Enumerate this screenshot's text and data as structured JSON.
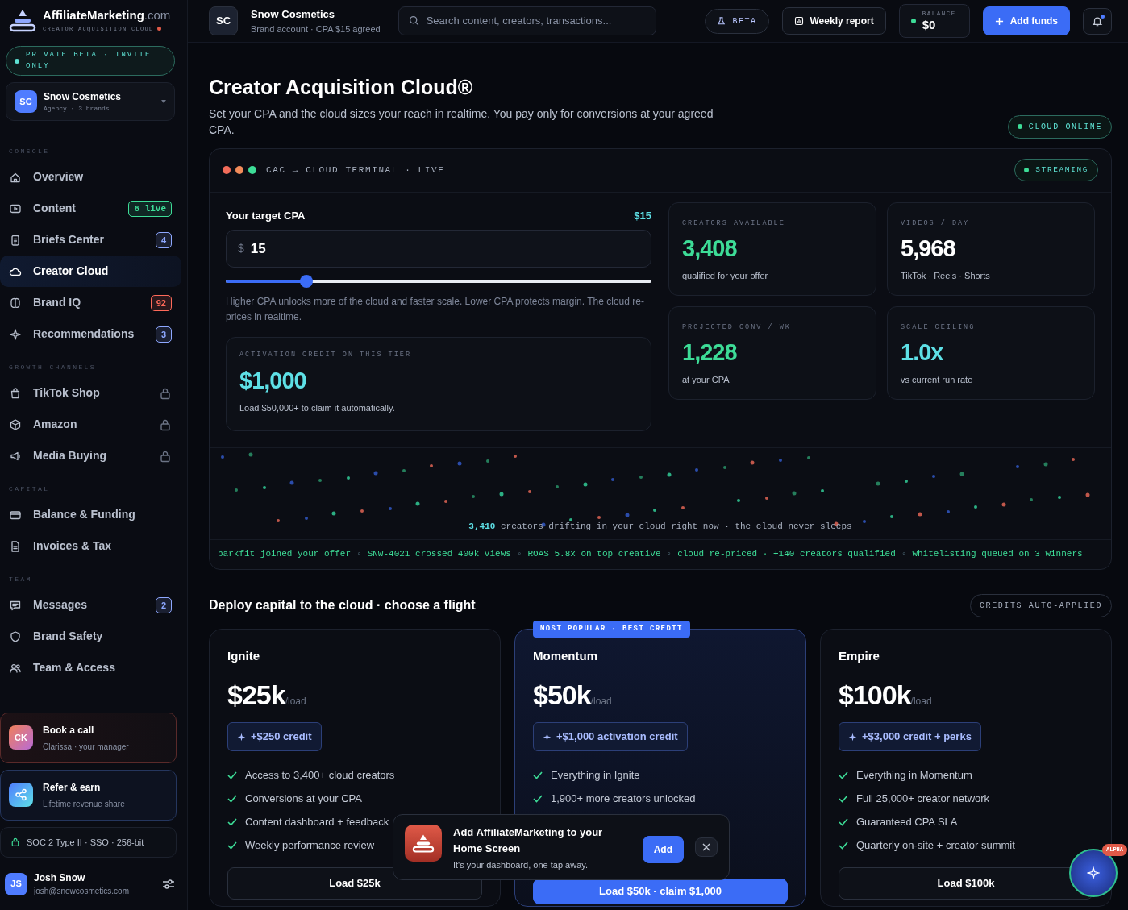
{
  "brand": {
    "name": "AffiliateMarketing",
    "suffix": ".com",
    "tagline": "CREATOR ACQUISITION CLOUD"
  },
  "beta_pill": "PRIVATE BETA · INVITE ONLY",
  "account_switcher": {
    "initials": "SC",
    "name": "Snow Cosmetics",
    "meta": "Agency · 3 brands"
  },
  "nav_sections": [
    {
      "heading": "CONSOLE",
      "items": [
        {
          "label": "Overview",
          "selected": false,
          "locked": false
        },
        {
          "label": "Content",
          "selected": false,
          "locked": false,
          "badge": "6 live",
          "color": "#3ddc97"
        },
        {
          "label": "Briefs Center",
          "selected": false,
          "locked": false,
          "badge": "4",
          "color": "#8ea8ff"
        },
        {
          "label": "Creator Cloud",
          "selected": true,
          "locked": false
        },
        {
          "label": "Brand IQ",
          "selected": false,
          "locked": false,
          "badge": "92",
          "color": "#ff6a5a"
        },
        {
          "label": "Recommendations",
          "selected": false,
          "locked": false,
          "badge": "3",
          "color": "#8ea8ff"
        }
      ]
    },
    {
      "heading": "GROWTH CHANNELS",
      "items": [
        {
          "label": "TikTok Shop",
          "selected": false,
          "locked": true
        },
        {
          "label": "Amazon",
          "selected": false,
          "locked": true
        },
        {
          "label": "Media Buying",
          "selected": false,
          "locked": true
        }
      ]
    },
    {
      "heading": "CAPITAL",
      "items": [
        {
          "label": "Balance & Funding",
          "selected": false,
          "locked": false
        },
        {
          "label": "Invoices & Tax",
          "selected": false,
          "locked": false
        }
      ]
    },
    {
      "heading": "TEAM",
      "items": [
        {
          "label": "Messages",
          "selected": false,
          "locked": false,
          "badge": "2",
          "color": "#8ea8ff"
        },
        {
          "label": "Brand Safety",
          "selected": false,
          "locked": false
        },
        {
          "label": "Team & Access",
          "selected": false,
          "locked": false
        }
      ]
    }
  ],
  "side_cards": [
    {
      "kind": "call",
      "initials": "CK",
      "title": "Book a call",
      "subtitle": "Clarissa · your manager"
    },
    {
      "kind": "refer",
      "title": "Refer & earn",
      "subtitle": "Lifetime revenue share"
    }
  ],
  "security_note": "SOC 2 Type II · SSO · 256-bit",
  "user": {
    "initials": "JS",
    "name": "Josh Snow",
    "email": "josh@snowcosmetics.com"
  },
  "topbar": {
    "initials": "SC",
    "name": "Snow Cosmetics",
    "meta": "Brand account · CPA $15 agreed",
    "search": {
      "placeholder": "Search content, creators, transactions..."
    },
    "beta": "BETA",
    "report": "Weekly report",
    "balance": {
      "label": "BALANCE",
      "value": "$0"
    },
    "add_funds": "Add funds",
    "notifications_unread": true
  },
  "hero": {
    "title": "Creator Acquisition Cloud®",
    "subtitle": "Set your CPA and the cloud sizes your reach in realtime. You pay only for conversions at your agreed CPA.",
    "status": "CLOUD ONLINE"
  },
  "terminal": {
    "title": "CAC → CLOUD TERMINAL · LIVE",
    "status": "STREAMING",
    "cpa": {
      "label": "Your target CPA",
      "reading": "$15",
      "currency": "$",
      "value": "15",
      "level": 0.19,
      "help": "Higher CPA unlocks more of the cloud and faster scale. Lower CPA protects margin. The cloud re-prices in realtime."
    },
    "credit": {
      "label": "ACTIVATION CREDIT ON THIS TIER",
      "value": "$1,000",
      "note": "Load $50,000+ to claim it automatically."
    },
    "stats": [
      {
        "label": "CREATORS AVAILABLE",
        "value": "3,408",
        "caption": "qualified for your offer",
        "color": "#3ddc97"
      },
      {
        "label": "VIDEOS / DAY",
        "value": "5,968",
        "caption": "TikTok · Reels · Shorts",
        "color": "#ffffff"
      },
      {
        "label": "PROJECTED CONV / WK",
        "value": "1,228",
        "caption": "at your CPA",
        "color": "#3ddc97"
      },
      {
        "label": "SCALE CEILING",
        "value": "1.0x",
        "caption": "vs current run rate",
        "color": "#5ee0e6"
      }
    ],
    "drift_caption": "**3,410** creators drifting in your cloud right now · the cloud never sleeps",
    "ticker": {
      "separator": "◦",
      "items": [
        "parkfit joined your offer",
        "SNW-4021 crossed 400k views",
        "ROAS 5.8x on top creative",
        "cloud re-priced · +140 creators qualified",
        "whitelisting queued on 3 winners"
      ]
    }
  },
  "plans_section": {
    "heading": "Deploy capital to the cloud · choose a flight",
    "badge": "CREDITS AUTO-APPLIED",
    "plans": [
      {
        "name": "Ignite",
        "price": "$25k",
        "unit": "/load",
        "credit": "+$250 credit",
        "featured": false,
        "features": [
          "Access to 3,400+ cloud creators",
          "Conversions at your CPA",
          "Content dashboard + feedback",
          "Weekly performance review"
        ],
        "cta": "Load $25k"
      },
      {
        "name": "Momentum",
        "price": "$50k",
        "unit": "/load",
        "credit": "+$1,000 activation credit",
        "featured": true,
        "ribbon": "MOST POPULAR · BEST CREDIT",
        "features": [
          "Everything in Ignite",
          "1,900+ more creators unlocked"
        ],
        "cta": "Load $50k · claim $1,000"
      },
      {
        "name": "Empire",
        "price": "$100k",
        "unit": "/load",
        "credit": "+$3,000 credit + perks",
        "featured": false,
        "features": [
          "Everything in Momentum",
          "Full 25,000+ creator network",
          "Guaranteed CPA SLA",
          "Quarterly on-site + creator summit"
        ],
        "cta": "Load $100k"
      }
    ]
  },
  "install_toast": {
    "title": "Add AffiliateMarketing to your Home Screen",
    "text": "It's your dashboard, one tap away.",
    "action": "Add"
  },
  "assistant": {
    "badge": "ALPHA"
  }
}
